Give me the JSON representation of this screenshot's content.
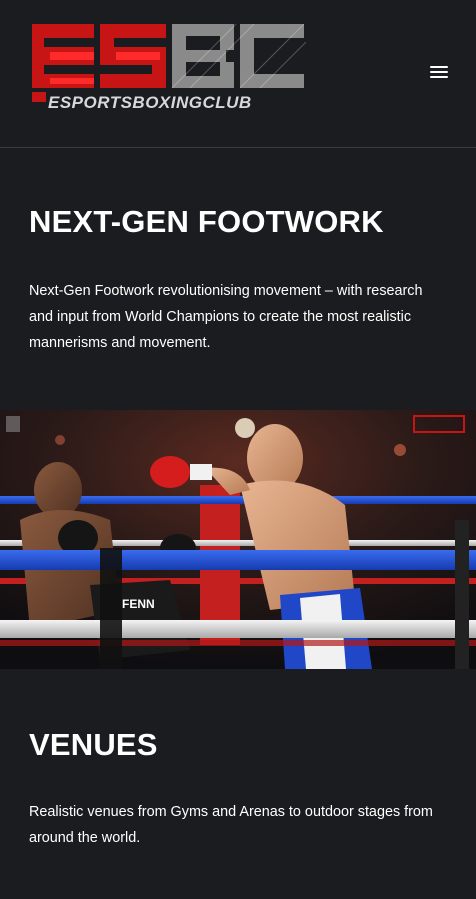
{
  "header": {
    "logo_alt": "ESBC Esports Boxing Club",
    "logo_mark": "ESBC",
    "logo_tagline": "ESPORTSBOXINGCLUB",
    "menu_icon": "hamburger-menu-icon"
  },
  "sections": [
    {
      "title": "NEXT-GEN FOOTWORK",
      "body": "Next-Gen Footwork revolutionising movement – with research and input from World Champions to create the most realistic mannerisms and movement."
    },
    {
      "title": "VENUES",
      "body": "Realistic venues from Gyms and Arenas to outdoor stages from around the world."
    }
  ],
  "hero_image": {
    "alt": "Two boxers fighting in a ring",
    "trunks_text": "FENN"
  },
  "colors": {
    "background": "#1b1c1f",
    "text": "#ffffff",
    "brand_red": "#d01818",
    "ring_blue": "#1f4fd0"
  }
}
